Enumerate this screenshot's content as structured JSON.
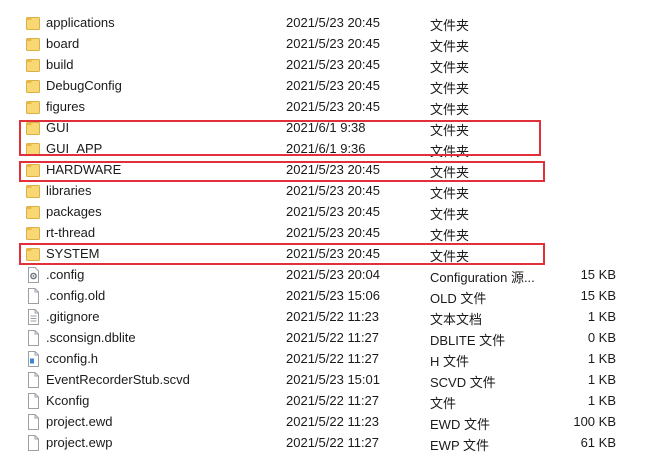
{
  "rows": [
    {
      "name": "applications",
      "date": "2021/5/23 20:45",
      "type": "文件夹",
      "size": "",
      "icon": "folder-icon"
    },
    {
      "name": "board",
      "date": "2021/5/23 20:45",
      "type": "文件夹",
      "size": "",
      "icon": "folder-icon"
    },
    {
      "name": "build",
      "date": "2021/5/23 20:45",
      "type": "文件夹",
      "size": "",
      "icon": "folder-icon"
    },
    {
      "name": "DebugConfig",
      "date": "2021/5/23 20:45",
      "type": "文件夹",
      "size": "",
      "icon": "folder-icon"
    },
    {
      "name": "figures",
      "date": "2021/5/23 20:45",
      "type": "文件夹",
      "size": "",
      "icon": "folder-icon"
    },
    {
      "name": "GUI",
      "date": "2021/6/1 9:38",
      "type": "文件夹",
      "size": "",
      "icon": "folder-icon"
    },
    {
      "name": "GUI_APP",
      "date": "2021/6/1 9:36",
      "type": "文件夹",
      "size": "",
      "icon": "folder-icon"
    },
    {
      "name": "HARDWARE",
      "date": "2021/5/23 20:45",
      "type": "文件夹",
      "size": "",
      "icon": "folder-icon"
    },
    {
      "name": "libraries",
      "date": "2021/5/23 20:45",
      "type": "文件夹",
      "size": "",
      "icon": "folder-icon"
    },
    {
      "name": "packages",
      "date": "2021/5/23 20:45",
      "type": "文件夹",
      "size": "",
      "icon": "folder-icon"
    },
    {
      "name": "rt-thread",
      "date": "2021/5/23 20:45",
      "type": "文件夹",
      "size": "",
      "icon": "folder-icon"
    },
    {
      "name": "SYSTEM",
      "date": "2021/5/23 20:45",
      "type": "文件夹",
      "size": "",
      "icon": "folder-icon"
    },
    {
      "name": ".config",
      "date": "2021/5/23 20:04",
      "type": "Configuration 源...",
      "size": "15 KB",
      "icon": "config-file-icon"
    },
    {
      "name": ".config.old",
      "date": "2021/5/23 15:06",
      "type": "OLD 文件",
      "size": "15 KB",
      "icon": "file-icon"
    },
    {
      "name": ".gitignore",
      "date": "2021/5/22 11:23",
      "type": "文本文档",
      "size": "1 KB",
      "icon": "text-file-icon"
    },
    {
      "name": ".sconsign.dblite",
      "date": "2021/5/22 11:27",
      "type": "DBLITE 文件",
      "size": "0 KB",
      "icon": "file-icon"
    },
    {
      "name": "cconfig.h",
      "date": "2021/5/22 11:27",
      "type": "H 文件",
      "size": "1 KB",
      "icon": "header-file-icon"
    },
    {
      "name": "EventRecorderStub.scvd",
      "date": "2021/5/23 15:01",
      "type": "SCVD 文件",
      "size": "1 KB",
      "icon": "file-icon"
    },
    {
      "name": "Kconfig",
      "date": "2021/5/22 11:27",
      "type": "文件",
      "size": "1 KB",
      "icon": "file-icon"
    },
    {
      "name": "project.ewd",
      "date": "2021/5/22 11:23",
      "type": "EWD 文件",
      "size": "100 KB",
      "icon": "file-icon"
    },
    {
      "name": "project.ewp",
      "date": "2021/5/22 11:27",
      "type": "EWP 文件",
      "size": "61 KB",
      "icon": "file-icon"
    }
  ],
  "colors": {
    "highlight_border": "#e0303a",
    "folder_fill": "#f8d775",
    "folder_tab": "#e8b84a"
  }
}
